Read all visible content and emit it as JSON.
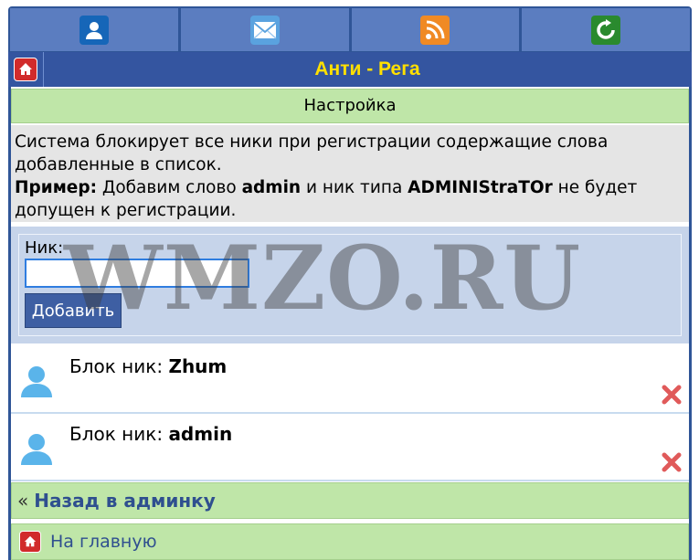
{
  "nav": {
    "items": [
      {
        "icon": "user-icon"
      },
      {
        "icon": "mail-icon"
      },
      {
        "icon": "rss-icon"
      },
      {
        "icon": "refresh-icon"
      }
    ]
  },
  "title": "Анти - Рега",
  "section_title": "Настройка",
  "description": {
    "text": "Система блокирует все ники при регистрации содержащие слова добавленные в список.",
    "example_label": "Пример:",
    "example_text_1": " Добавим слово ",
    "example_word": "admin",
    "example_text_2": " и ник типа ",
    "example_nick": "ADMINIStraTOr",
    "example_text_3": " не будет допущен к регистрации."
  },
  "form": {
    "label": "Ник:",
    "value": "",
    "button": "Добавить"
  },
  "blocked": [
    {
      "prefix": "Блок ник: ",
      "nick": "Zhum"
    },
    {
      "prefix": "Блок ник: ",
      "nick": "admin"
    }
  ],
  "footer": {
    "back_arrow": "«",
    "back_label": "Назад в админку",
    "home_label": "На главную"
  },
  "watermark": "WMZO.RU",
  "colors": {
    "header_blue": "#3455a0",
    "nav_blue": "#5b7dc0",
    "title_yellow": "#ffe000",
    "green_bar": "#bfe6a8",
    "link_blue": "#2f4f8f",
    "delete_red": "#e05a5a"
  }
}
